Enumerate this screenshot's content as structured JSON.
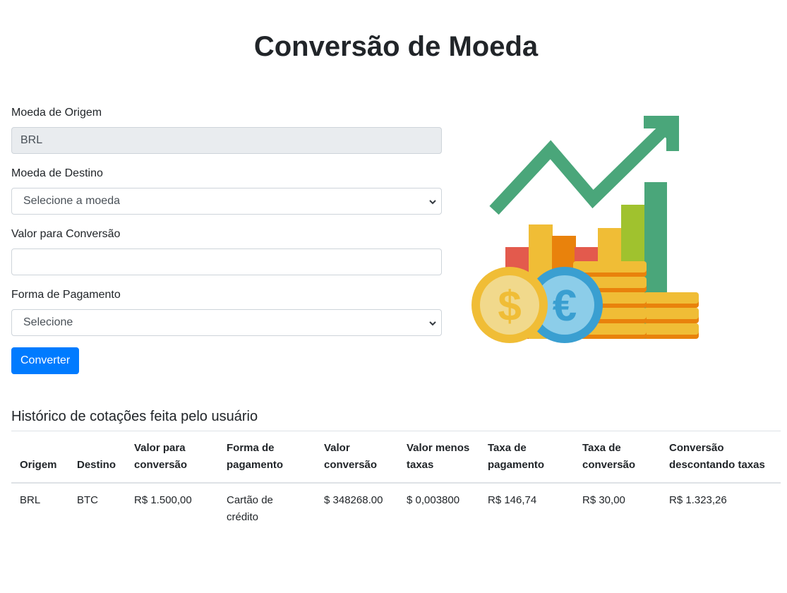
{
  "page": {
    "title": "Conversão de Moeda"
  },
  "form": {
    "origin_label": "Moeda de Origem",
    "origin_value": "BRL",
    "destination_label": "Moeda de Destino",
    "destination_selected": "Selecione a moeda",
    "amount_label": "Valor para Conversão",
    "amount_value": "",
    "payment_label": "Forma de Pagamento",
    "payment_selected": "Selecione",
    "convert_button": "Converter"
  },
  "illustration": {
    "icon": "finance-growth-illustration",
    "colors": {
      "green": "#4aa67a",
      "yellow": "#f0bd36",
      "orange": "#e9820c",
      "red": "#e35a4d",
      "lime": "#a0c22e",
      "blue": "#3a9fd1",
      "lightblue": "#8ccde9"
    }
  },
  "history": {
    "title": "Histórico de cotações feita pelo usuário",
    "columns": [
      "Origem",
      "Destino",
      "Valor para conversão",
      "Forma de pagamento",
      "Valor conversão",
      "Valor menos taxas",
      "Taxa de pagamento",
      "Taxa de conversão",
      "Conversão descontando taxas"
    ],
    "rows": [
      {
        "origem": "BRL",
        "destino": "BTC",
        "valor": "R$ 1.500,00",
        "forma": "Cartão de crédito",
        "valor_conversao": "$ 348268.00",
        "valor_menos_taxas": "$ 0,003800",
        "taxa_pagamento": "R$ 146,74",
        "taxa_conversao": "R$ 30,00",
        "conversao_descontando": "R$ 1.323,26"
      }
    ]
  }
}
